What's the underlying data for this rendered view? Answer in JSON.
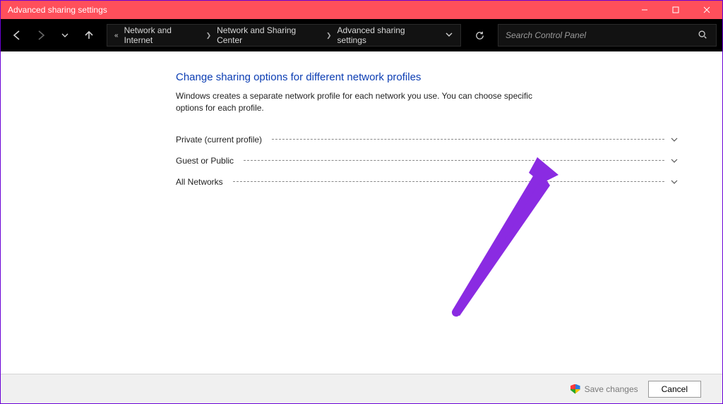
{
  "window": {
    "title": "Advanced sharing settings"
  },
  "breadcrumb": {
    "items": [
      "Network and Internet",
      "Network and Sharing Center",
      "Advanced sharing settings"
    ]
  },
  "search": {
    "placeholder": "Search Control Panel"
  },
  "page": {
    "title": "Change sharing options for different network profiles",
    "description": "Windows creates a separate network profile for each network you use. You can choose specific options for each profile."
  },
  "profiles": [
    {
      "label": "Private (current profile)"
    },
    {
      "label": "Guest or Public"
    },
    {
      "label": "All Networks"
    }
  ],
  "footer": {
    "save": "Save changes",
    "cancel": "Cancel"
  }
}
